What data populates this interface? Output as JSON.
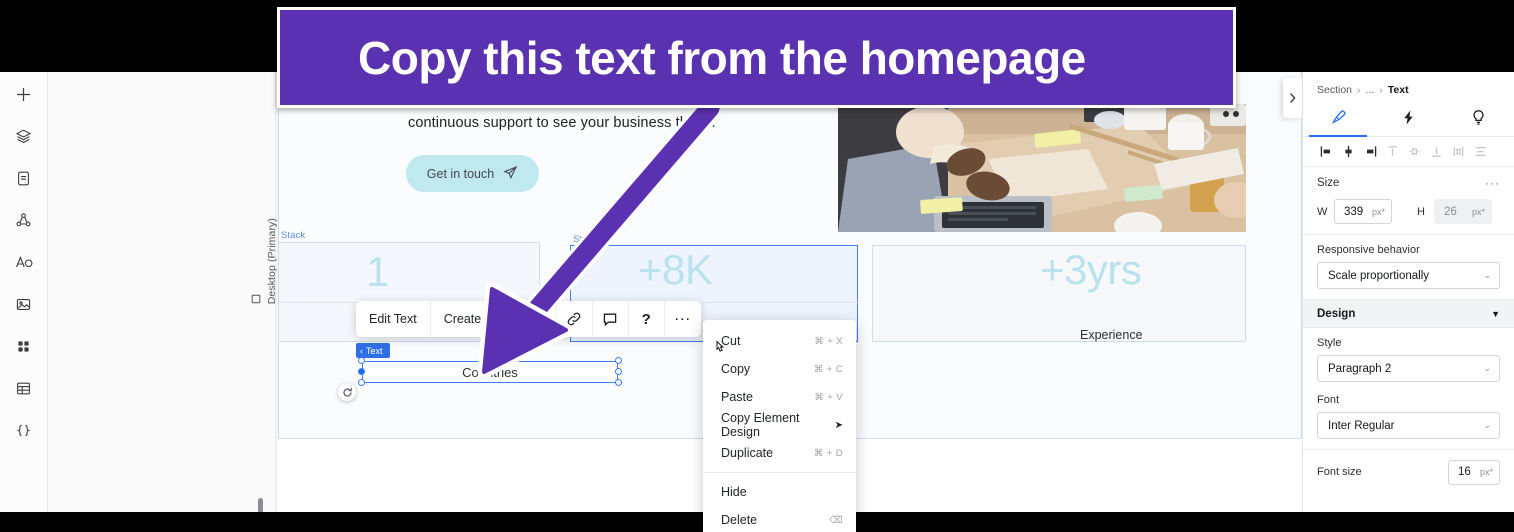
{
  "annotation": {
    "banner_text": "Copy this text from the homepage",
    "banner_color": "#5A31B0",
    "arrow_color": "#5A31B0"
  },
  "left_rail": {
    "items": [
      {
        "name": "add-icon",
        "glyph": "+"
      },
      {
        "name": "layers-icon",
        "glyph": "layers"
      },
      {
        "name": "pages-icon",
        "glyph": "page"
      },
      {
        "name": "site-map-icon",
        "glyph": "sitemap"
      },
      {
        "name": "theme-icon",
        "glyph": "theme"
      },
      {
        "name": "media-icon",
        "glyph": "image"
      },
      {
        "name": "apps-icon",
        "glyph": "apps"
      },
      {
        "name": "cms-icon",
        "glyph": "table"
      },
      {
        "name": "dev-mode-icon",
        "glyph": "{ }"
      }
    ]
  },
  "workspace": {
    "device_label": "Desktop (Primary)"
  },
  "canvas": {
    "hero_paragraph": "continuous support to see your business thrive.",
    "cta_label": "Get in touch",
    "stack_label_left": "Stack",
    "stack_label_right": "Stack",
    "stats": [
      {
        "value": "1",
        "caption": "Countries"
      },
      {
        "value": "+8K",
        "caption": ""
      },
      {
        "value": "+3yrs",
        "caption": "Experience"
      }
    ],
    "selected_element": {
      "text": "Countries",
      "badge_label": "Text"
    }
  },
  "element_toolbar": {
    "edit_text_label": "Edit Text",
    "create_ai_label": "Create AI T",
    "icons": [
      {
        "name": "move-down-icon",
        "glyph": "↓"
      },
      {
        "name": "link-icon",
        "glyph": "link"
      },
      {
        "name": "comment-icon",
        "glyph": "comment"
      },
      {
        "name": "help-icon",
        "glyph": "?"
      },
      {
        "name": "more-options-icon",
        "glyph": "..."
      }
    ]
  },
  "context_menu": {
    "items": [
      {
        "label": "Cut",
        "shortcut": "⌘ + X",
        "submenu": false
      },
      {
        "label": "Copy",
        "shortcut": "⌘ + C",
        "submenu": false
      },
      {
        "label": "Paste",
        "shortcut": "⌘ + V",
        "submenu": false
      },
      {
        "label": "Copy Element Design",
        "shortcut": "",
        "submenu": true
      },
      {
        "label": "Duplicate",
        "shortcut": "⌘ + D",
        "submenu": false
      }
    ],
    "items_after_separator": [
      {
        "label": "Hide",
        "shortcut": ""
      },
      {
        "label": "Delete",
        "shortcut": "⌫"
      }
    ]
  },
  "right_panel": {
    "breadcrumb": {
      "root": "Section",
      "ellipsis": "...",
      "current": "Text"
    },
    "tabs": [
      {
        "name": "design-tab",
        "icon": "paintbrush-icon",
        "active": true
      },
      {
        "name": "interactions-tab",
        "icon": "lightning-icon",
        "active": false
      },
      {
        "name": "insights-tab",
        "icon": "lightbulb-icon",
        "active": false
      }
    ],
    "size": {
      "title": "Size",
      "width_label": "W",
      "width_value": "339",
      "width_unit": "px*",
      "height_label": "H",
      "height_value": "26",
      "height_unit": "px*"
    },
    "responsive": {
      "label": "Responsive behavior",
      "value": "Scale proportionally"
    },
    "design": {
      "title": "Design",
      "style_label": "Style",
      "style_value": "Paragraph 2",
      "font_label": "Font",
      "font_value": "Inter Regular",
      "font_size_label": "Font size",
      "font_size_value": "16",
      "font_size_unit": "px*"
    }
  }
}
